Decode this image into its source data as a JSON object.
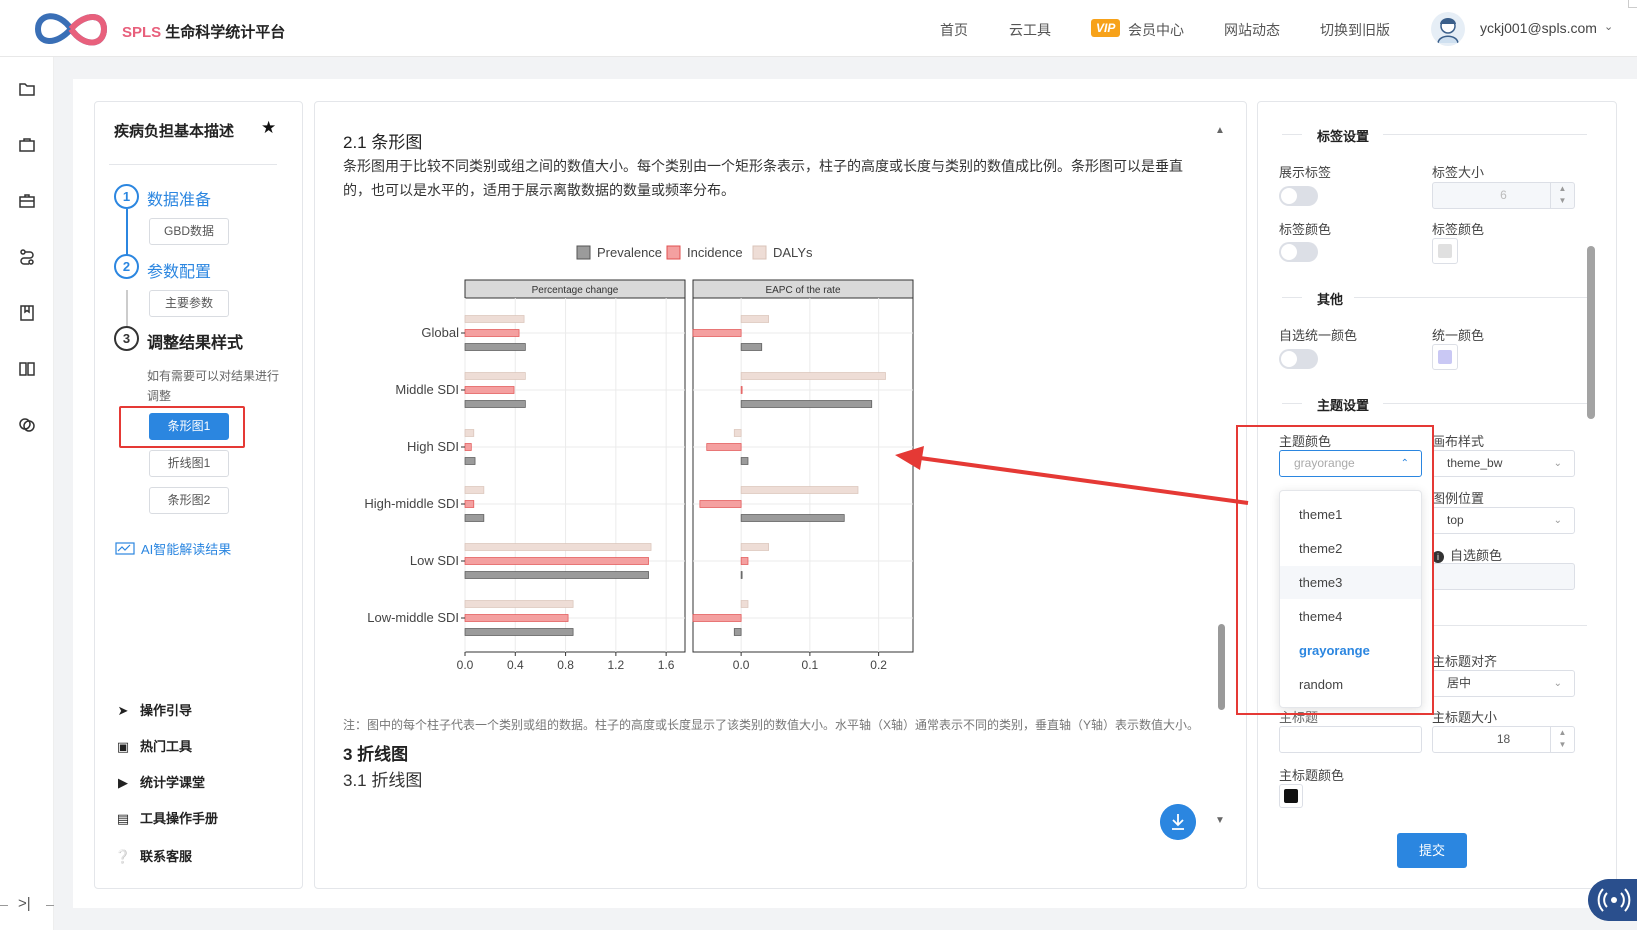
{
  "header": {
    "brand_en": "SPLS",
    "brand_cn": "生命科学统计平台",
    "nav": [
      {
        "label": "首页"
      },
      {
        "label": "云工具"
      },
      {
        "label": "会员中心",
        "badge": "VIP"
      },
      {
        "label": "网站动态"
      },
      {
        "label": "切换到旧版"
      }
    ],
    "user": "yckj001@spls.com",
    "brand_colors": {
      "logo_blue": "#3a6fb6",
      "logo_pink": "#e8607c",
      "accent": "#2b86e0",
      "vip": "#f7a21a"
    }
  },
  "rail": {
    "icons": [
      "folder-icon",
      "briefcase-icon",
      "toolbox-icon",
      "route-icon",
      "bookmark-icon",
      "book-icon",
      "chat-icon"
    ]
  },
  "left_panel": {
    "title": "疾病负担基本描述",
    "steps": [
      {
        "num": "1",
        "label": "数据准备",
        "items": [
          "GBD数据"
        ]
      },
      {
        "num": "2",
        "label": "参数配置",
        "items": [
          "主要参数"
        ]
      },
      {
        "num": "3",
        "label": "调整结果样式",
        "hint": "如有需要可以对结果进行调整",
        "items": [
          "条形图1",
          "折线图1",
          "条形图2"
        ],
        "active": "条形图1"
      }
    ],
    "ai_link": "AI智能解读结果",
    "links": [
      {
        "icon": "send-icon",
        "label": "操作引导"
      },
      {
        "icon": "briefcase-icon",
        "label": "热门工具"
      },
      {
        "icon": "video-icon",
        "label": "统计学课堂"
      },
      {
        "icon": "document-icon",
        "label": "工具操作手册"
      },
      {
        "icon": "help-icon",
        "label": "联系客服"
      }
    ]
  },
  "content": {
    "section_title": "2.1 条形图",
    "section_desc": "条形图用于比较不同类别或组之间的数值大小。每个类别由一个矩形条表示，柱子的高度或长度与类别的数值成比例。条形图可以是垂直的，也可以是水平的，适用于展示离散数据的数量或频率分布。",
    "note": "注：图中的每个柱子代表一个类别或组的数据。柱子的高度或长度显示了该类别的数值大小。水平轴（X轴）通常表示不同的类别，垂直轴（Y轴）表示数值大小。",
    "h3": "3 折线图",
    "h31": "3.1 折线图"
  },
  "chart_data": {
    "type": "bar",
    "orientation": "horizontal",
    "legend_position": "top",
    "categories": [
      "Global",
      "Middle SDI",
      "High SDI",
      "High-middle SDI",
      "Low SDI",
      "Low-middle SDI"
    ],
    "panels": [
      {
        "title": "Percentage change",
        "xlim": [
          0,
          1.75
        ],
        "xticks": [
          "0.0",
          "0.4",
          "0.8",
          "1.2",
          "1.6"
        ],
        "series": [
          {
            "name": "Prevalence",
            "values": [
              0.48,
              0.48,
              0.08,
              0.15,
              1.46,
              0.86
            ]
          },
          {
            "name": "Incidence",
            "values": [
              0.43,
              0.39,
              0.05,
              0.07,
              1.46,
              0.82
            ]
          },
          {
            "name": "DALYs",
            "values": [
              0.47,
              0.48,
              0.07,
              0.15,
              1.48,
              0.86
            ]
          }
        ]
      },
      {
        "title": "EAPC of the rate",
        "xlim": [
          -0.07,
          0.25
        ],
        "xticks": [
          "0.0",
          "0.1",
          "0.2"
        ],
        "series": [
          {
            "name": "Prevalence",
            "values": [
              0.03,
              0.19,
              0.01,
              0.15,
              0.0,
              -0.01
            ]
          },
          {
            "name": "Incidence",
            "values": [
              -0.07,
              0.0,
              -0.05,
              -0.06,
              0.01,
              -0.07
            ]
          },
          {
            "name": "DALYs",
            "values": [
              0.04,
              0.21,
              -0.01,
              0.17,
              0.04,
              0.01
            ]
          }
        ]
      }
    ],
    "colors": {
      "Prevalence": "#9b9b9b",
      "Incidence": "#f4a0a0",
      "DALYs": "#eeddd6"
    },
    "outline": {
      "Prevalence": "#555555",
      "Incidence": "#e05050",
      "DALYs": "#d9c3b8"
    }
  },
  "right_panel": {
    "label_section": "标签设置",
    "show_label": "展示标签",
    "label_size": "标签大小",
    "label_size_value": "6",
    "label_color": "标签颜色",
    "label_color2": "标签颜色",
    "other_section": "其他",
    "custom_unified_color": "自选统一颜色",
    "unified_color": "统一颜色",
    "theme_section": "主题设置",
    "theme_color": "主题颜色",
    "theme_color_value": "grayorange",
    "canvas_style": "画布样式",
    "canvas_style_value": "theme_bw",
    "legend_position": "图例位置",
    "legend_position_value": "top",
    "custom_color": "自选颜色",
    "title_align": "主标题对齐",
    "title_align_value": "居中",
    "main_title": "主标题",
    "title_size": "主标题大小",
    "title_size_value": "18",
    "title_color": "主标题颜色",
    "submit": "提交",
    "dropdown_options": [
      "theme1",
      "theme2",
      "theme3",
      "theme4",
      "grayorange",
      "random"
    ],
    "dropdown_hover": "theme3",
    "dropdown_selected": "grayorange"
  }
}
